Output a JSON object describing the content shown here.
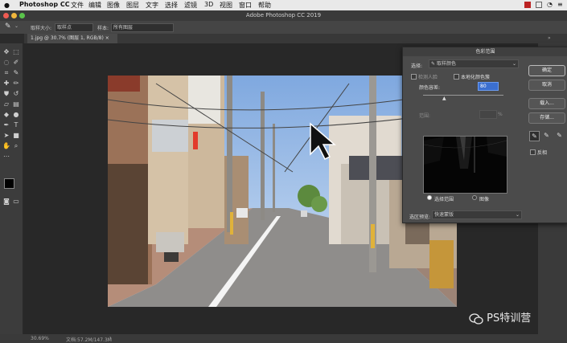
{
  "macbar": {
    "app_name": "Photoshop CC",
    "menus": [
      "文件",
      "编辑",
      "图像",
      "图层",
      "文字",
      "选择",
      "滤镜",
      "3D",
      "视图",
      "窗口",
      "帮助"
    ]
  },
  "window": {
    "title": "Adobe Photoshop CC 2019"
  },
  "options_bar": {
    "sample_size_label": "取样大小:",
    "sample_size_value": "取样点",
    "sample_label": "样本:",
    "sample_value": "所有图层"
  },
  "document": {
    "tab_label": "1.jpg @ 30.7% (图层 1, RGB/8) ×"
  },
  "status_bar": {
    "zoom": "30.69%",
    "doc_size": "文档:57.2M/147.3M"
  },
  "dialog": {
    "title": "色彩范围",
    "select_label": "选择:",
    "select_value": "取样颜色",
    "detect_faces_label": "检测人脸",
    "localized_label": "本地化颜色簇",
    "fuzziness_label": "颜色容差:",
    "fuzziness_value": "80",
    "range_label": "范围:",
    "range_unit": "%",
    "radio_selection": "选择范围",
    "radio_image": "图像",
    "preview_label": "选区预览:",
    "preview_value": "快速蒙版",
    "buttons": {
      "ok": "确定",
      "cancel": "取消",
      "load": "载入...",
      "save": "存储..."
    },
    "invert_label": "反相",
    "fuzziness_fraction": 0.27
  },
  "watermark": {
    "text": "PS特训营"
  },
  "colors": {
    "dialog_bg": "#4b4b4b",
    "accent_field": "#3b6fd0",
    "close_red": "#c0392b"
  }
}
